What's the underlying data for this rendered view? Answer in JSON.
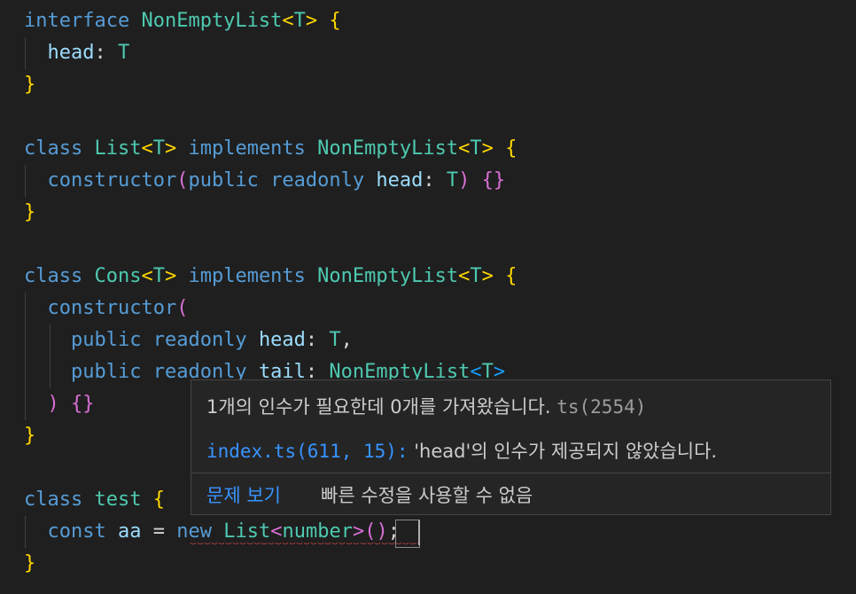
{
  "code": {
    "l1": {
      "kw": "interface",
      "name": "NonEmptyList",
      "lt": "<",
      "tp": "T",
      "gt": ">",
      "brace": "{"
    },
    "l2": {
      "prop": "head",
      "colon": ":",
      "type": "T"
    },
    "l3": {
      "brace": "}"
    },
    "l5": {
      "kw": "class",
      "name": "List",
      "lt": "<",
      "tp": "T",
      "gt": ">",
      "impl": "implements",
      "iface": "NonEmptyList",
      "lt2": "<",
      "tp2": "T",
      "gt2": ">",
      "brace": "{"
    },
    "l6": {
      "ctor": "constructor",
      "open": "(",
      "pub": "public",
      "ro": "readonly",
      "prop": "head",
      "colon": ":",
      "type": "T",
      "close": ")",
      "body_open": "{",
      "body_close": "}"
    },
    "l7": {
      "brace": "}"
    },
    "l9": {
      "kw": "class",
      "name": "Cons",
      "lt": "<",
      "tp": "T",
      "gt": ">",
      "impl": "implements",
      "iface": "NonEmptyList",
      "lt2": "<",
      "tp2": "T",
      "gt2": ">",
      "brace": "{"
    },
    "l10": {
      "ctor": "constructor",
      "open": "("
    },
    "l11": {
      "pub": "public",
      "ro": "readonly",
      "prop": "head",
      "colon": ":",
      "type": "T",
      "comma": ","
    },
    "l12": {
      "pub": "public",
      "ro": "readonly",
      "prop": "tail",
      "colon": ":",
      "iface": "NonEmptyList",
      "lt": "<",
      "tp": "T",
      "gt": ">"
    },
    "l13": {
      "close": ")",
      "body_open": "{",
      "body_close": "}"
    },
    "l14": {
      "brace": "}"
    },
    "l16": {
      "kw": "class",
      "name": "test",
      "brace": "{"
    },
    "l17": {
      "kw": "const",
      "var": "aa",
      "eq": "=",
      "new": "new",
      "cls": "List",
      "lt": "<",
      "tp": "number",
      "gt": ">",
      "open": "(",
      "close": ")",
      "semi": ";"
    },
    "l18": {
      "brace": "}"
    }
  },
  "hover": {
    "message": "1개의 인수가 필요한데 0개를 가져왔습니다.",
    "code": "ts(2554)",
    "related_link": "index.ts(611, 15):",
    "related_text": "'head'의 인수가 제공되지 않았습니다.",
    "view_problem": "문제 보기",
    "no_quick_fix": "빠른 수정을 사용할 수 없음"
  },
  "colors": {
    "background": "#1f1f1f",
    "keyword": "#569cd6",
    "type": "#4ec9b0",
    "function": "#dcdcaa",
    "property": "#9cdcfe",
    "bracket1": "#ffd700",
    "bracket2": "#da70d6",
    "bracket3": "#179fff",
    "error": "#f14c4c",
    "link": "#3794ff"
  }
}
